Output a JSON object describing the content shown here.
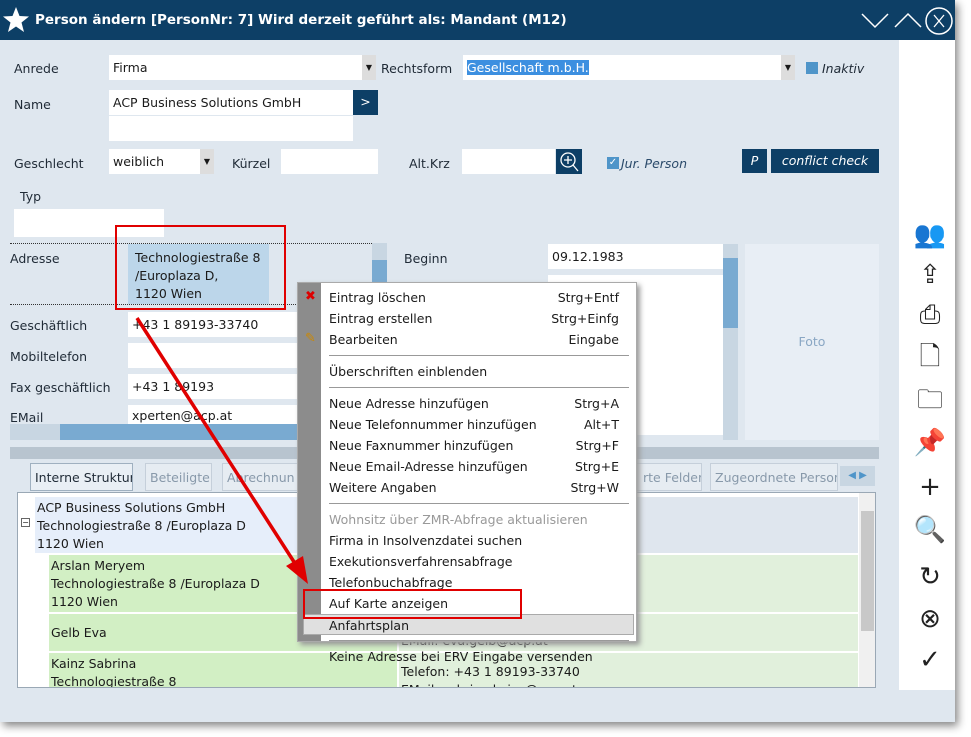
{
  "window": {
    "title": "Person ändern  [PersonNr: 7] Wird derzeit geführt als: Mandant (M12)"
  },
  "form": {
    "anrede_label": "Anrede",
    "anrede_value": "Firma",
    "rechtsform_label": "Rechtsform",
    "rechtsform_value": "Gesellschaft m.b.H.",
    "inaktiv_label": "Inaktiv",
    "inaktiv_checked": false,
    "name_label": "Name",
    "name_value": "ACP Business Solutions GmbH",
    "name_value2": "",
    "name_button": ">",
    "geschlecht_label": "Geschlecht",
    "geschlecht_value": "weiblich",
    "kuerzel_label": "Kürzel",
    "kuerzel_value": "",
    "altkrz_label": "Alt.Krz",
    "altkrz_value": "",
    "jur_person_label": "Jur. Person",
    "jur_person_checked": true,
    "p_button": "P",
    "conflict_button": "conflict check",
    "typ_label": "Typ",
    "typ_value": ""
  },
  "contact": {
    "rows": [
      {
        "label": "Adresse",
        "value": "Technologiestraße 8\n/Europlaza D,\n1120 Wien"
      },
      {
        "label": "Geschäftlich",
        "value": "+43 1 89193-33740"
      },
      {
        "label": "Mobiltelefon",
        "value": ""
      },
      {
        "label": "Fax geschäftlich",
        "value": "+43 1 89193"
      },
      {
        "label": "EMail",
        "value": "xperten@acp.at"
      }
    ],
    "beginn_label": "Beginn",
    "beginn_value": "09.12.1983",
    "foto_label": "Foto"
  },
  "tabs": [
    "Interne Struktur",
    "Beteiligte",
    "Abrechnun",
    "rte Felder",
    "Zugeordnete Person"
  ],
  "tree": [
    {
      "left": "ACP Business Solutions GmbH\nTechnologiestraße 8 /Europlaza D\n1120 Wien",
      "right": ""
    },
    {
      "left": "Arslan Meryem\nTechnologiestraße 8 /Europlaza D\n1120 Wien",
      "right": ""
    },
    {
      "left": "Gelb Eva",
      "right": "EMail: eva.gelb@acp.at"
    },
    {
      "left": "Kainz Sabrina\nTechnologiestraße 8",
      "right": "Telefon: +43 1 89193-33740\nEMail: sabrina.kainz@acp.at"
    }
  ],
  "context_menu": {
    "items": [
      {
        "label": "Eintrag löschen",
        "shortcut": "Strg+Entf",
        "icon": "delete-x-icon"
      },
      {
        "label": "Eintrag erstellen",
        "shortcut": "Strg+Einfg"
      },
      {
        "label": "Bearbeiten",
        "shortcut": "Eingabe",
        "icon": "pencil-icon"
      },
      {
        "sep": true
      },
      {
        "label": "Überschriften einblenden",
        "shortcut": ""
      },
      {
        "sep": true
      },
      {
        "label": "Neue Adresse hinzufügen",
        "shortcut": "Strg+A"
      },
      {
        "label": "Neue Telefonnummer hinzufügen",
        "shortcut": "Alt+T"
      },
      {
        "label": "Neue Faxnummer hinzufügen",
        "shortcut": "Strg+F"
      },
      {
        "label": "Neue Email-Adresse hinzufügen",
        "shortcut": "Strg+E"
      },
      {
        "label": "Weitere Angaben",
        "shortcut": "Strg+W"
      },
      {
        "sep": true
      },
      {
        "label": "Wohnsitz über ZMR-Abfrage aktualisieren",
        "shortcut": "",
        "disabled": true
      },
      {
        "label": "Firma in Insolvenzdatei suchen",
        "shortcut": ""
      },
      {
        "label": "Exekutionsverfahrensabfrage",
        "shortcut": ""
      },
      {
        "label": "Telefonbuchabfrage",
        "shortcut": ""
      },
      {
        "label": "Auf Karte anzeigen",
        "shortcut": ""
      },
      {
        "label": "Anfahrtsplan",
        "shortcut": "",
        "highlighted": true
      },
      {
        "sep": true
      },
      {
        "label": "Keine Adresse bei ERV Eingabe versenden",
        "shortcut": ""
      }
    ]
  },
  "toolbar": [
    "users-icon",
    "share-icon",
    "print-icon",
    "new-document-icon",
    "folder-icon",
    "pin-icon",
    "add-icon",
    "document-search-icon",
    "refresh-icon",
    "cancel-icon",
    "confirm-icon"
  ],
  "colors": {
    "title_bar": "#0d3f66",
    "accent": "#4f95c9",
    "annotation": "#e00000"
  }
}
